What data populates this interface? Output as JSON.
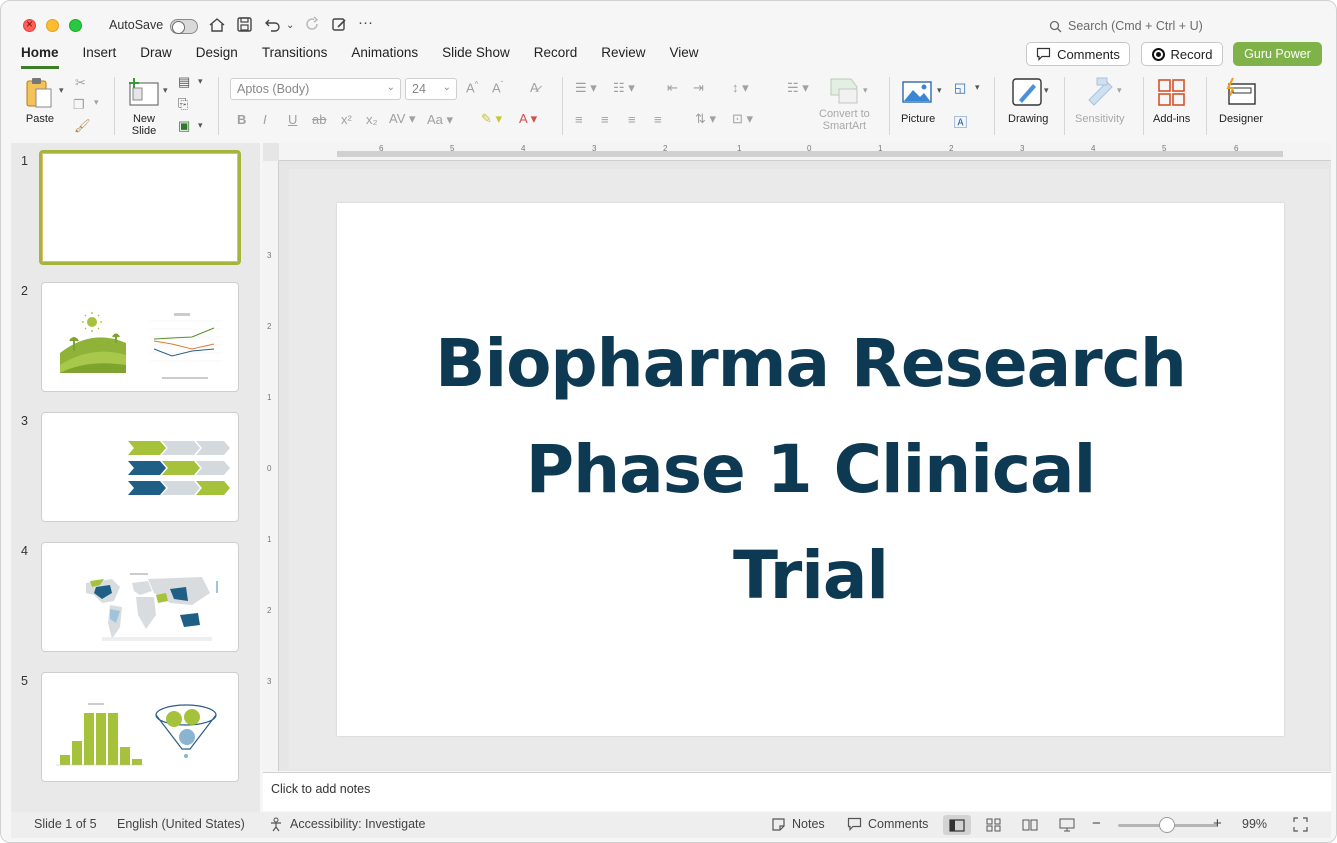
{
  "titlebar": {
    "autosave_label": "AutoSave",
    "search_placeholder": "Search (Cmd + Ctrl + U)"
  },
  "tabs": [
    {
      "label": "Home",
      "active": true
    },
    {
      "label": "Insert"
    },
    {
      "label": "Draw"
    },
    {
      "label": "Design"
    },
    {
      "label": "Transitions"
    },
    {
      "label": "Animations"
    },
    {
      "label": "Slide Show"
    },
    {
      "label": "Record"
    },
    {
      "label": "Review"
    },
    {
      "label": "View"
    }
  ],
  "header_buttons": {
    "comments": "Comments",
    "record": "Record",
    "guru": "Guru Power"
  },
  "ribbon": {
    "paste": "Paste",
    "new_slide": "New\nSlide",
    "font_name": "Aptos (Body)",
    "font_size": "24",
    "convert_smartart": "Convert to\nSmartArt",
    "picture": "Picture",
    "drawing": "Drawing",
    "sensitivity": "Sensitivity",
    "addins": "Add-ins",
    "designer": "Designer"
  },
  "thumbnails": [
    {
      "number": "1",
      "selected": true
    },
    {
      "number": "2"
    },
    {
      "number": "3"
    },
    {
      "number": "4"
    },
    {
      "number": "5"
    }
  ],
  "slide": {
    "title_lines": [
      "Biopharma Research",
      "Phase 1 Clinical",
      "Trial"
    ]
  },
  "notes": {
    "placeholder": "Click to add notes"
  },
  "status": {
    "slide_count": "Slide 1 of 5",
    "language": "English (United States)",
    "accessibility": "Accessibility: Investigate",
    "notes": "Notes",
    "comments": "Comments",
    "zoom": "99%"
  },
  "colors": {
    "accent_green": "#7fb34a",
    "title_navy": "#0d3a52",
    "chart_blue": "#1f5e85",
    "chart_gray": "#d4d9de"
  }
}
